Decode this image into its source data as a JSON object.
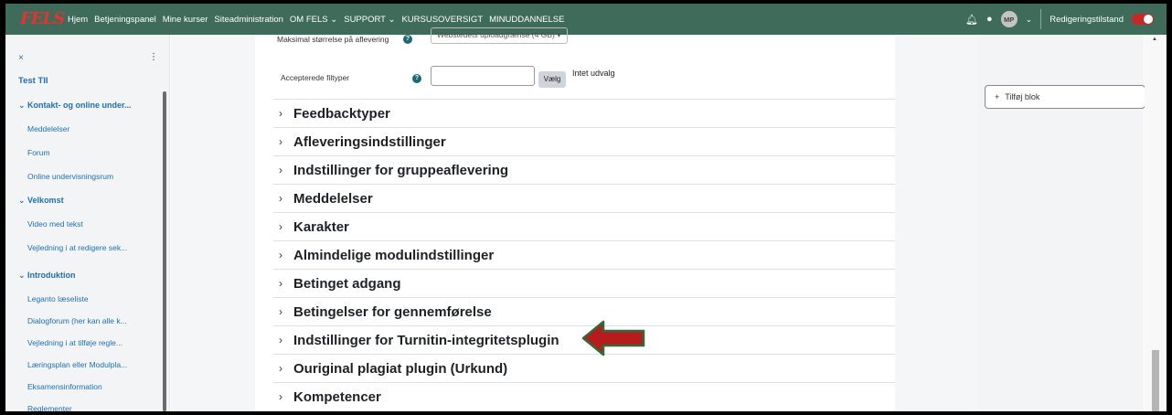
{
  "navbar": {
    "logo": "FELS",
    "items": [
      "Hjem",
      "Betjeningspanel",
      "Mine kurser",
      "Siteadministration",
      "OM FELS",
      "SUPPORT",
      "KURSUSOVERSIGT",
      "MINUDDANNELSE"
    ],
    "dropdown_items": [
      "OM FELS",
      "SUPPORT"
    ],
    "avatar": "MP",
    "edit_mode_label": "Redigeringstilstand",
    "bell_icon": "bell-icon",
    "chat_icon": "chat-icon"
  },
  "drawer": {
    "close": "×",
    "menu": "⋮",
    "course_title": "Test TII",
    "sections": [
      {
        "label": "Kontakt- og online under...",
        "links": [
          "Meddelelser",
          "Forum",
          "Online undervisningsrum"
        ]
      },
      {
        "label": "Velkomst",
        "links": [
          "Video med tekst",
          "Vejledning i at redigere sek..."
        ]
      },
      {
        "label": "Introduktion",
        "links": [
          "Leganto læseliste",
          "Dialogforum (her kan alle k...",
          "Vejledning i at tilføje regle...",
          "Læringsplan eller Modulpla...",
          "Eksamensinformation",
          "Reglementer"
        ]
      }
    ]
  },
  "form": {
    "max_size_label": "Maksimal størrelse på aflevering",
    "max_size_value": "Webstedets uploadgrænse (4 GB)",
    "filetypes_label": "Accepterede filtyper",
    "choose_button": "Vælg",
    "no_selection": "Intet udvalg"
  },
  "sections": [
    "Feedbacktyper",
    "Afleveringsindstillinger",
    "Indstillinger for gruppeaflevering",
    "Meddelelser",
    "Karakter",
    "Almindelige modulindstillinger",
    "Betinget adgang",
    "Betingelser for gennemførelse",
    "Indstillinger for Turnitin-integritetsplugin",
    "Ouriginal plagiat plugin (Urkund)",
    "Kompetencer"
  ],
  "right": {
    "add_block": "Tilføj blok"
  },
  "colors": {
    "navbar": "#3e6b5a",
    "link": "#1f6fb2",
    "arrow": "#b71c1c",
    "arrow_border": "#2e6b3a"
  }
}
